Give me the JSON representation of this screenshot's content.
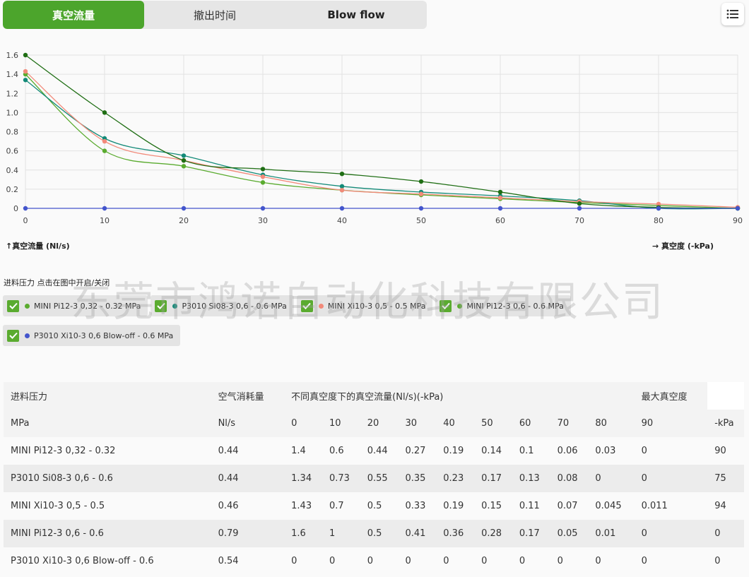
{
  "tabs": [
    {
      "label": "真空流量"
    },
    {
      "label": "撤出时间"
    },
    {
      "label": "Blow flow"
    }
  ],
  "menu": {
    "icon": "list-icon"
  },
  "chart_data": {
    "type": "line",
    "x": [
      0,
      10,
      20,
      30,
      40,
      50,
      60,
      70,
      80,
      90
    ],
    "y_ticks": [
      "1.6",
      "1.4",
      "1.2",
      "1.0",
      "0.8",
      "0.6",
      "0.4",
      "0.2",
      "0"
    ],
    "x_ticks": [
      "0",
      "10",
      "20",
      "30",
      "40",
      "50",
      "60",
      "70",
      "80",
      "90"
    ],
    "ylim": [
      0,
      1.6
    ],
    "xlim": [
      0,
      90
    ],
    "grid": true,
    "ylabel": "↑真空流量 (Nl/s)",
    "xlabel": "→ 真空度 (-kPa)",
    "series": [
      {
        "name": "MINI Pi12-3 0,32 - 0.32 MPa",
        "color": "#5aab2f",
        "values": [
          1.4,
          0.6,
          0.44,
          0.27,
          0.19,
          0.14,
          0.1,
          0.06,
          0.03,
          0
        ]
      },
      {
        "name": "P3010 Si08-3 0,6 - 0.6 MPa",
        "color": "#138a78",
        "values": [
          1.34,
          0.73,
          0.55,
          0.35,
          0.23,
          0.17,
          0.13,
          0.08,
          0,
          0
        ]
      },
      {
        "name": "MINI Xi10-3 0,5 - 0.5 MPa",
        "color": "#f28a7a",
        "values": [
          1.43,
          0.7,
          0.5,
          0.33,
          0.19,
          0.15,
          0.11,
          0.07,
          0.045,
          0.011
        ]
      },
      {
        "name": "MINI Pi12-3 0,6 - 0.6 MPa",
        "color": "#1f6e14",
        "values": [
          1.6,
          1.0,
          0.5,
          0.41,
          0.36,
          0.28,
          0.17,
          0.05,
          0.01,
          0
        ]
      },
      {
        "name": "P3010 Xi10-3 0,6 Blow-off - 0.6 MPa",
        "color": "#4355cc",
        "values": [
          0,
          0,
          0,
          0,
          0,
          0,
          0,
          0,
          0,
          0
        ]
      }
    ]
  },
  "legend": {
    "title": "进料压力 点击在图中开启/关闭",
    "items": [
      {
        "label": "MINI Pi12-3 0,32 - 0.32 MPa",
        "color": "#5aab2f"
      },
      {
        "label": "P3010 Si08-3 0,6 - 0.6 MPa",
        "color": "#138a78"
      },
      {
        "label": "MINI Xi10-3 0,5 - 0.5 MPa",
        "color": "#f28a7a"
      },
      {
        "label": "MINI Pi12-3 0,6 - 0.6 MPa",
        "color": "#5aab2f"
      },
      {
        "label": "P3010 Xi10-3 0,6 Blow-off - 0.6 MPa",
        "color": "#4355cc"
      }
    ]
  },
  "watermark": "东莞市鸿诺自动化科技有限公司",
  "table": {
    "header1": {
      "c0": "进料压力",
      "c1": "空气消耗量",
      "c2": "不同真空度下的真空流量(Nl/s)(-kPa)",
      "c3": "最大真空度"
    },
    "header2": [
      "MPa",
      "Nl/s",
      "0",
      "10",
      "20",
      "30",
      "40",
      "50",
      "60",
      "70",
      "80",
      "90",
      "-kPa"
    ],
    "rows": [
      [
        "MINI Pi12-3 0,32 - 0.32",
        "0.44",
        "1.4",
        "0.6",
        "0.44",
        "0.27",
        "0.19",
        "0.14",
        "0.1",
        "0.06",
        "0.03",
        "0",
        "90"
      ],
      [
        "P3010 Si08-3 0,6 - 0.6",
        "0.44",
        "1.34",
        "0.73",
        "0.55",
        "0.35",
        "0.23",
        "0.17",
        "0.13",
        "0.08",
        "0",
        "0",
        "75"
      ],
      [
        "MINI Xi10-3 0,5 - 0.5",
        "0.46",
        "1.43",
        "0.7",
        "0.5",
        "0.33",
        "0.19",
        "0.15",
        "0.11",
        "0.07",
        "0.045",
        "0.011",
        "94"
      ],
      [
        "MINI Pi12-3 0,6 - 0.6",
        "0.79",
        "1.6",
        "1",
        "0.5",
        "0.41",
        "0.36",
        "0.28",
        "0.17",
        "0.05",
        "0.01",
        "0",
        "0"
      ],
      [
        "P3010 Xi10-3 0,6 Blow-off - 0.6",
        "0.54",
        "0",
        "0",
        "0",
        "0",
        "0",
        "0",
        "0",
        "0",
        "0",
        "0",
        "0"
      ]
    ]
  }
}
